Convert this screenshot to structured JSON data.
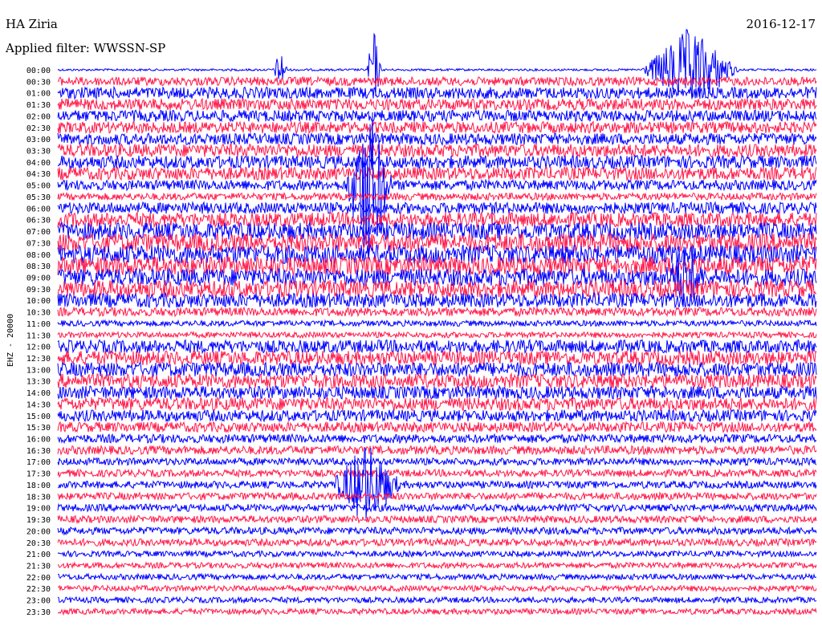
{
  "header": {
    "station": "HA Ziria",
    "date": "2016-12-17",
    "filter_label": "Applied filter: WWSSN-SP"
  },
  "colors": {
    "trace_a": "#0000ff",
    "trace_b": "#ff1a4b",
    "background": "#ffffff",
    "text": "#000000"
  },
  "chart_data": {
    "type": "line",
    "subtype": "helicorder",
    "ylabel": "EHZ - 20000",
    "row_labels": [
      "00:00",
      "00:30",
      "01:00",
      "01:30",
      "02:00",
      "02:30",
      "03:00",
      "03:30",
      "04:00",
      "04:30",
      "05:00",
      "05:30",
      "06:00",
      "06:30",
      "07:00",
      "07:30",
      "08:00",
      "08:30",
      "09:00",
      "09:30",
      "10:00",
      "10:30",
      "11:00",
      "11:30",
      "12:00",
      "12:30",
      "13:00",
      "13:30",
      "14:00",
      "14:30",
      "15:00",
      "15:30",
      "16:00",
      "16:30",
      "17:00",
      "17:30",
      "18:00",
      "18:30",
      "19:00",
      "19:30",
      "20:00",
      "20:30",
      "21:00",
      "21:30",
      "22:00",
      "22:30",
      "23:00",
      "23:30"
    ],
    "trace_colors_cycle": [
      "blue",
      "red"
    ],
    "row_minutes": 30,
    "legend": "none",
    "grid": false,
    "noise_amplitude_by_row": [
      0.15,
      0.6,
      0.8,
      0.8,
      0.8,
      0.8,
      0.8,
      0.9,
      0.9,
      0.9,
      0.7,
      0.5,
      0.8,
      1.0,
      1.2,
      1.3,
      1.3,
      1.3,
      1.2,
      1.2,
      1.0,
      0.6,
      0.4,
      0.4,
      0.9,
      1.0,
      1.0,
      1.0,
      0.9,
      0.9,
      0.8,
      0.7,
      0.6,
      0.6,
      0.5,
      0.5,
      0.5,
      0.5,
      0.5,
      0.5,
      0.5,
      0.5,
      0.4,
      0.4,
      0.4,
      0.4,
      0.4,
      0.4
    ],
    "events": [
      {
        "time": "00:00",
        "minute": 8.8,
        "amplitude": 3.0,
        "duration_min": 0.3
      },
      {
        "time": "00:00",
        "minute": 12.5,
        "amplitude": 6.0,
        "duration_min": 0.3
      },
      {
        "time": "00:00",
        "minute": 25.0,
        "amplitude": 6.0,
        "duration_min": 2.0
      },
      {
        "time": "05:00",
        "minute": 12.3,
        "amplitude": 12.0,
        "duration_min": 1.0
      },
      {
        "time": "09:00",
        "minute": 24.8,
        "amplitude": 5.0,
        "duration_min": 1.0
      },
      {
        "time": "18:00",
        "minute": 12.2,
        "amplitude": 6.0,
        "duration_min": 1.5
      }
    ]
  }
}
